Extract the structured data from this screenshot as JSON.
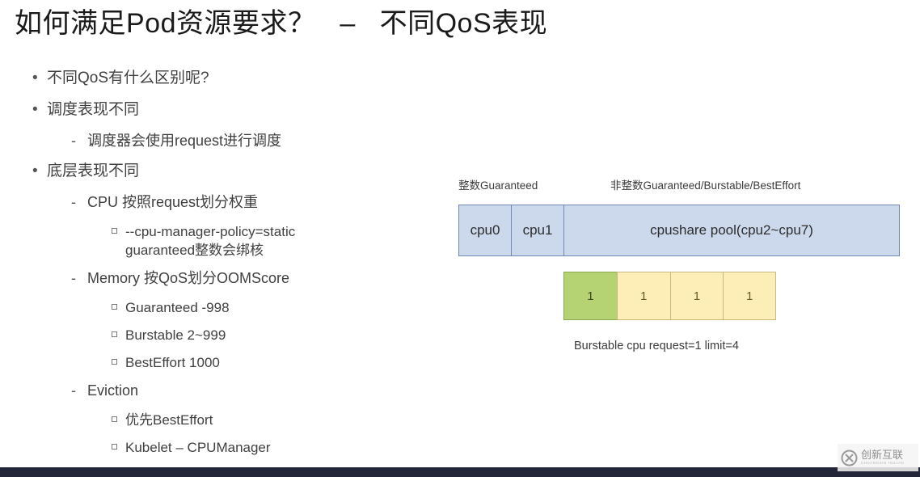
{
  "slide": {
    "title": "如何满足Pod资源要求？   –   不同QoS表现"
  },
  "bullets": [
    {
      "level": 1,
      "marker": "•",
      "text": "不同QoS有什么区别呢?"
    },
    {
      "level": 1,
      "marker": "•",
      "text": "调度表现不同"
    },
    {
      "level": 2,
      "marker": "-",
      "text": "调度器会使用request进行调度"
    },
    {
      "level": 1,
      "marker": "•",
      "text": "底层表现不同"
    },
    {
      "level": 2,
      "marker": "-",
      "text": "CPU 按照request划分权重"
    },
    {
      "level": 3,
      "marker": "square",
      "text": "--cpu-manager-policy=static\nguaranteed整数会绑核"
    },
    {
      "level": 2,
      "marker": "-",
      "text": "Memory 按QoS划分OOMScore"
    },
    {
      "level": 3,
      "marker": "square",
      "text": "Guaranteed -998"
    },
    {
      "level": 3,
      "marker": "square",
      "text": "Burstable 2~999"
    },
    {
      "level": 3,
      "marker": "square",
      "text": "BestEffort 1000"
    },
    {
      "level": 2,
      "marker": "-",
      "text": "Eviction"
    },
    {
      "level": 3,
      "marker": "square",
      "text": "优先BestEffort"
    },
    {
      "level": 3,
      "marker": "square",
      "text": "Kubelet – CPUManager"
    }
  ],
  "diagram": {
    "label_integer": "整数Guaranteed",
    "label_noninteger": "非整数Guaranteed/Burstable/BestEffort",
    "cpu_cells": [
      "cpu0",
      "cpu1"
    ],
    "cpu_pool": "cpushare pool(cpu2~cpu7)",
    "quota_cells": [
      "1",
      "1",
      "1",
      "1"
    ],
    "caption": "Burstable cpu request=1 limit=4",
    "colors": {
      "cpu_fill": "#ccd9ec",
      "cpu_border": "#7089b5",
      "green_fill": "#b5d373",
      "yellow_fill": "#fdeeb8",
      "cell_border": "#9a9a6a"
    }
  },
  "watermark": {
    "brand_cn": "创新互联",
    "brand_en": "CHUANGXIN HULIAN",
    "logo": "circled-x-logo"
  },
  "footer": {
    "bar_color": "#232639"
  }
}
